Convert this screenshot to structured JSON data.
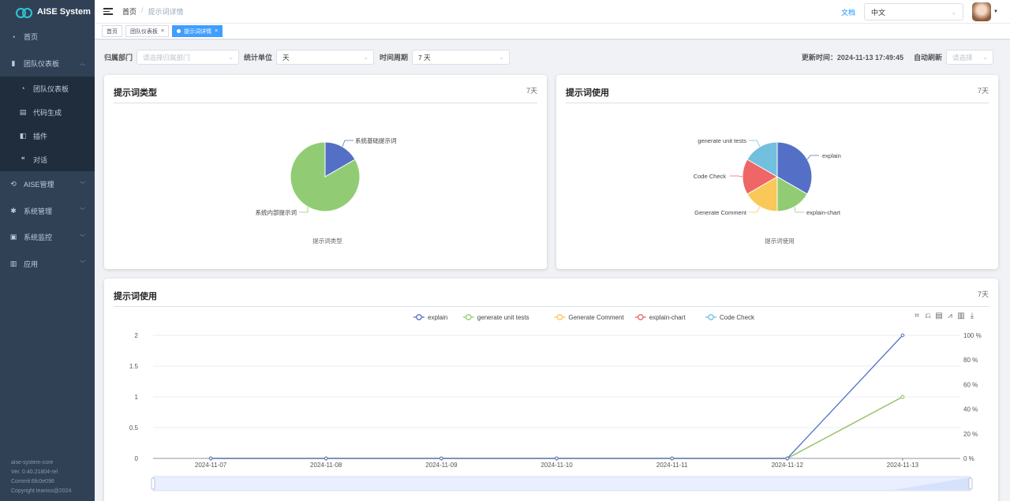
{
  "app": {
    "name": "AISE System"
  },
  "sidebar": {
    "items": [
      {
        "label": "首页",
        "icon": "dashboard-icon",
        "type": "item"
      },
      {
        "label": "团队仪表板",
        "icon": "bar-chart-icon",
        "type": "group",
        "expanded": true
      },
      {
        "label": "团队仪表板",
        "icon": "dashboard-icon",
        "type": "sub"
      },
      {
        "label": "代码生成",
        "icon": "code-icon",
        "type": "sub"
      },
      {
        "label": "插件",
        "icon": "plugin-icon",
        "type": "sub"
      },
      {
        "label": "对话",
        "icon": "chat-icon",
        "type": "sub"
      },
      {
        "label": "AISE管理",
        "icon": "cog-hand-icon",
        "type": "group"
      },
      {
        "label": "系统管理",
        "icon": "gear-icon",
        "type": "group"
      },
      {
        "label": "系统监控",
        "icon": "monitor-icon",
        "type": "group"
      },
      {
        "label": "应用",
        "icon": "app-icon",
        "type": "group"
      }
    ],
    "footer": [
      "aise-system-core",
      "Ver. 0.40.21804-rel",
      "Commit:6fc0e096",
      "Copyright leaniss@2024"
    ]
  },
  "navbar": {
    "breadcrumb": [
      "首页",
      "提示词详情"
    ],
    "doc_link": "文档",
    "language": "中文"
  },
  "tags": [
    {
      "label": "首页",
      "active": false,
      "closable": false
    },
    {
      "label": "团队仪表板",
      "active": false,
      "closable": true
    },
    {
      "label": "提示词详情",
      "active": true,
      "closable": true
    }
  ],
  "filters": {
    "department_label": "归属部门",
    "department_placeholder": "请选择归属部门",
    "unit_label": "统计单位",
    "unit_value": "天",
    "period_label": "时间周期",
    "period_value": "7 天",
    "update_time": "更新时间：2024-11-13 17:49:45",
    "auto_refresh_label": "自动刷新",
    "auto_refresh_placeholder": "请选择"
  },
  "cards": {
    "type_card": {
      "title": "提示词类型",
      "badge": "7天"
    },
    "usage_card": {
      "title": "提示词使用",
      "badge": "7天"
    },
    "trend_card": {
      "title": "提示词使用",
      "badge": "7天"
    }
  },
  "colors": {
    "blue": "#5470c6",
    "green": "#91cc75",
    "yellow": "#fac858",
    "red": "#ee6666",
    "cyan": "#73c0de",
    "sidebar_bg": "#304156",
    "accent": "#409eff"
  },
  "chart_data": [
    {
      "type": "pie",
      "caption": "提示词类型",
      "slices": [
        {
          "name": "系统基础提示词",
          "value": 1,
          "color": "#5470c6"
        },
        {
          "name": "系统内部提示词",
          "value": 5,
          "color": "#91cc75"
        }
      ]
    },
    {
      "type": "pie",
      "caption": "提示词使用",
      "slices": [
        {
          "name": "explain",
          "value": 1,
          "color": "#5470c6"
        },
        {
          "name": "explain-chart",
          "value": 0.5,
          "color": "#91cc75"
        },
        {
          "name": "Generate Comment",
          "value": 0.5,
          "color": "#fac858"
        },
        {
          "name": "Code Check",
          "value": 0.5,
          "color": "#ee6666"
        },
        {
          "name": "generate unit tests",
          "value": 0.5,
          "color": "#73c0de"
        }
      ]
    },
    {
      "type": "line",
      "x": [
        "2024-11-07",
        "2024-11-08",
        "2024-11-09",
        "2024-11-10",
        "2024-11-11",
        "2024-11-12",
        "2024-11-13"
      ],
      "y_ticks": [
        "0",
        "0.5",
        "1",
        "1.5",
        "2"
      ],
      "ylim": [
        0,
        2
      ],
      "y2_ticks": [
        "0 %",
        "20 %",
        "40 %",
        "60 %",
        "80 %",
        "100 %"
      ],
      "legend": [
        "explain",
        "generate unit tests",
        "Generate Comment",
        "explain-chart",
        "Code Check"
      ],
      "series": [
        {
          "name": "explain",
          "color": "#5470c6",
          "values": [
            0,
            0,
            0,
            0,
            0,
            0,
            2
          ]
        },
        {
          "name": "generate unit tests",
          "color": "#91cc75",
          "values": [
            0,
            0,
            0,
            0,
            0,
            0,
            1
          ]
        },
        {
          "name": "Generate Comment",
          "color": "#fac858",
          "values": [
            0,
            0,
            0,
            0,
            0,
            0,
            1
          ]
        },
        {
          "name": "explain-chart",
          "color": "#ee6666",
          "values": [
            0,
            0,
            0,
            0,
            0,
            0,
            1
          ]
        },
        {
          "name": "Code Check",
          "color": "#73c0de",
          "values": [
            0,
            0,
            0,
            0,
            0,
            0,
            1
          ]
        }
      ]
    }
  ]
}
